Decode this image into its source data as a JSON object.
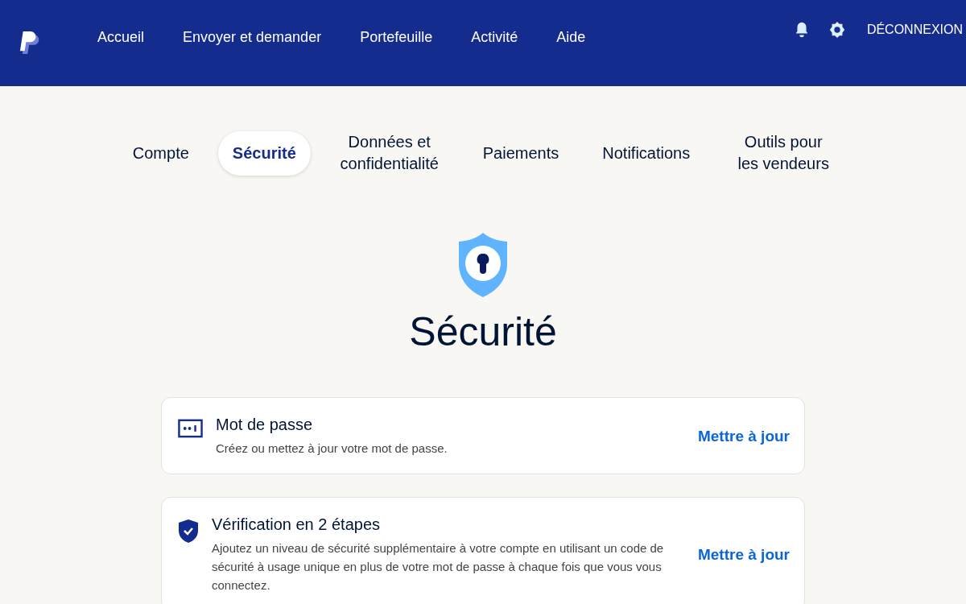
{
  "nav": {
    "links": [
      "Accueil",
      "Envoyer et demander",
      "Portefeuille",
      "Activité",
      "Aide"
    ],
    "logout": "DÉCONNEXION"
  },
  "tabs": [
    {
      "label": "Compte",
      "selected": false
    },
    {
      "label": "Sécurité",
      "selected": true
    },
    {
      "label": "Données et confidentialité",
      "selected": false
    },
    {
      "label": "Paiements",
      "selected": false
    },
    {
      "label": "Notifications",
      "selected": false
    },
    {
      "label": "Outils pour les vendeurs",
      "selected": false
    }
  ],
  "page_title": "Sécurité",
  "cards": [
    {
      "kind": "password",
      "title": "Mot de passe",
      "description": "Créez ou mettez à jour votre mot de passe.",
      "action": "Mettre à jour"
    },
    {
      "kind": "two-step",
      "title": "Vérification en 2 étapes",
      "description": "Ajoutez un niveau de sécurité supplémentaire à votre compte en utilisant un code de sécurité à usage unique en plus de votre mot de passe à chaque fois que vous vous connectez.",
      "action": "Mettre à jour"
    }
  ]
}
